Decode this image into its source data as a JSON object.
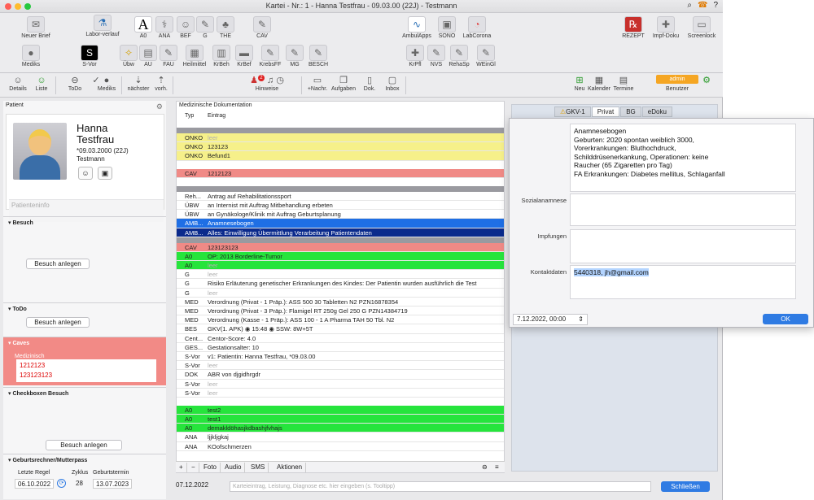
{
  "window": {
    "title": "Kartei - Nr.: 1 - Hanna Testfrau - 09.03.00 (22J)  -  Testmann"
  },
  "toolbar_top": [
    {
      "label": "Neuer Brief",
      "icon": "✉"
    },
    {
      "label": "Labor-verlauf",
      "icon": "⚗"
    },
    {
      "label": "A0",
      "icon": "A"
    },
    {
      "label": "ANA",
      "icon": "⚕"
    },
    {
      "label": "BEF",
      "icon": "☺"
    },
    {
      "label": "G",
      "icon": "✎"
    },
    {
      "label": "THE",
      "icon": "♣"
    },
    {
      "label": "CAV",
      "icon": "✎"
    },
    {
      "label": "AmbulApps",
      "icon": "∿"
    },
    {
      "label": "SONO",
      "icon": "▣"
    },
    {
      "label": "LabCorona",
      "icon": "◔"
    },
    {
      "label": "REZEPT",
      "icon": "℞"
    },
    {
      "label": "Impf-Doku",
      "icon": "✚"
    },
    {
      "label": "Screenlock",
      "icon": "▭"
    }
  ],
  "toolbar_mid": [
    {
      "label": "Mediks",
      "icon": "●"
    },
    {
      "label": "S-Vor",
      "icon": "S"
    },
    {
      "label": "Übw",
      "icon": "✧"
    },
    {
      "label": "AU",
      "icon": "▤"
    },
    {
      "label": "FAU",
      "icon": "✎"
    },
    {
      "label": "Heilmittel",
      "icon": "▦"
    },
    {
      "label": "KrBeh",
      "icon": "▥"
    },
    {
      "label": "KrBef",
      "icon": "▬"
    },
    {
      "label": "KrebsFF",
      "icon": "✎"
    },
    {
      "label": "MG",
      "icon": "✎"
    },
    {
      "label": "BESCH",
      "icon": "✎"
    },
    {
      "label": "KrPfl",
      "icon": "✚"
    },
    {
      "label": "NVS",
      "icon": "✎"
    },
    {
      "label": "RehaSp",
      "icon": "✎"
    },
    {
      "label": "WEinGl",
      "icon": "✎"
    }
  ],
  "navbar": {
    "details": "Details",
    "liste": "Liste",
    "todo": "ToDo",
    "mediks": "Mediks",
    "naechster": "nächster",
    "vorh": "vorh.",
    "hinweise": "Hinweise",
    "hinweise_badge": "2",
    "nachr": "+Nachr.",
    "aufgaben": "Aufgaben",
    "dok": "Dok.",
    "inbox": "Inbox",
    "neu": "Neu",
    "kalender": "Kalender",
    "termine": "Termine",
    "benutzer": "Benutzer",
    "user_badge": "admin"
  },
  "patient": {
    "header": "Patient",
    "first_name": "Hanna",
    "last_name": "Testfrau",
    "dob": "*09.03.2000 (22J)",
    "doctor": "Testmann",
    "info_placeholder": "Patienteninfo"
  },
  "sections": {
    "besuch": {
      "title": "Besuch",
      "button": "Besuch anlegen"
    },
    "todo": {
      "title": "ToDo",
      "button": "Besuch anlegen"
    },
    "caves": {
      "title": "Caves",
      "sub": "Medizinisch",
      "items": [
        "1212123",
        "123123123"
      ]
    },
    "checkboxen": {
      "title": "Checkboxen Besuch",
      "button": "Besuch anlegen"
    },
    "geburt": {
      "title": "Geburtsrechner/Mutterpass",
      "letzte_regel_label": "Letzte Regel",
      "letzte_regel": "06.10.2022",
      "zyklus_label": "Zyklus",
      "zyklus": "28",
      "geburtstermin_label": "Geburtstermin",
      "geburtstermin": "13.07.2023"
    }
  },
  "center": {
    "title": "Medizinische Dokumentation",
    "col_typ": "Typ",
    "col_eintrag": "Eintrag",
    "rows": [
      {
        "kind": "sep-grey"
      },
      {
        "kind": "yellow",
        "typ": "ONKO",
        "text": "leer",
        "ph": true
      },
      {
        "kind": "yellow",
        "typ": "ONKO",
        "text": "123123"
      },
      {
        "kind": "yellow",
        "typ": "ONKO",
        "text": "Befund1"
      },
      {
        "kind": "gap"
      },
      {
        "kind": "red",
        "typ": "CAV",
        "text": "1212123"
      },
      {
        "kind": "gap"
      },
      {
        "kind": "sep-grey"
      },
      {
        "kind": "",
        "typ": "Reh...",
        "text": "Antrag auf Rehabilitationssport"
      },
      {
        "kind": "",
        "typ": "ÜBW",
        "text": "an Internist mit Auftrag Mitbehandlung erbeten"
      },
      {
        "kind": "",
        "typ": "ÜBW",
        "text": "an Gynäkologe/Klinik mit Auftrag Geburtsplanung"
      },
      {
        "kind": "blue",
        "typ": "AMB...",
        "text": "Anamnesebogen"
      },
      {
        "kind": "navy",
        "typ": "AMB...",
        "text": "Alles: Einwilligung Übermittlung Verarbeitung Patientendaten"
      },
      {
        "kind": "sep-grey"
      },
      {
        "kind": "red",
        "typ": "CAV",
        "text": "123123123"
      },
      {
        "kind": "green",
        "typ": "A0",
        "text": "OP: 2013 Borderline-Tumor"
      },
      {
        "kind": "green",
        "typ": "A0",
        "text": "leer",
        "ph": true
      },
      {
        "kind": "",
        "typ": "G",
        "text": "leer",
        "ph": true
      },
      {
        "kind": "",
        "typ": "G",
        "text": "Risiko Erläuterung genetischer Erkrankungen des Kindes: Der Patientin wurden ausführlich die Test"
      },
      {
        "kind": "",
        "typ": "G",
        "text": "leer",
        "ph": true
      },
      {
        "kind": "",
        "typ": "MED",
        "text": "Verordnung (Privat - 1 Präp.): ASS 500 30 Tabletten N2 PZN16878354"
      },
      {
        "kind": "",
        "typ": "MED",
        "text": "Verordnung (Privat - 3 Präp.): Flamigel RT 250g Gel 250 G PZN14384719"
      },
      {
        "kind": "",
        "typ": "MED",
        "text": "Verordnung (Kasse - 1 Präp.): ASS 100 - 1 A Pharma TAH 50 Tbl. N2"
      },
      {
        "kind": "",
        "typ": "BES",
        "text": "GKV(1. APK) ◉ 15:48 ◉ SSW: 8W+5T"
      },
      {
        "kind": "",
        "typ": "Cent...",
        "text": "Centor-Score: 4.0"
      },
      {
        "kind": "",
        "typ": "GES...",
        "text": "Gestationsalter: 10"
      },
      {
        "kind": "",
        "typ": "S-Vor",
        "text": "v1: Patientin: Hanna Testfrau, *09.03.00"
      },
      {
        "kind": "",
        "typ": "S-Vor",
        "text": "leer",
        "ph": true
      },
      {
        "kind": "",
        "typ": "DOK",
        "text": "ABR von djgidhrgdr"
      },
      {
        "kind": "",
        "typ": "S-Vor",
        "text": "leer",
        "ph": true
      },
      {
        "kind": "",
        "typ": "S-Vor",
        "text": "leer",
        "ph": true
      },
      {
        "kind": "gap"
      },
      {
        "kind": "green",
        "typ": "A0",
        "text": "test2"
      },
      {
        "kind": "green",
        "typ": "A0",
        "text": "test1"
      },
      {
        "kind": "green",
        "typ": "A0",
        "text": "demakldöhasjkdbashjfvhajs"
      },
      {
        "kind": "",
        "typ": "ANA",
        "text": "ljjkljgkaj"
      },
      {
        "kind": "",
        "typ": "ANA",
        "text": "KOofschmerzen"
      }
    ],
    "bottom": {
      "plus": "+",
      "minus": "−",
      "foto": "Foto",
      "audio": "Audio",
      "sms": "SMS",
      "aktionen": "Aktionen"
    }
  },
  "input_bar": {
    "date": "07.12.2022",
    "placeholder": "Karteieintrag, Leistung, Diagnose etc. hier eingeben (s. Tooltipp)",
    "close": "Schließen"
  },
  "right_tabs": [
    "GKV-1",
    "Privat",
    "BG",
    "eDoku"
  ],
  "popup": {
    "anamnese_lines": [
      "Anamnesebogen",
      "Geburten: 2020 spontan weiblich 3000,",
      "Vorerkrankungen: Bluthochdruck,",
      "Schilddrüsenerkankung, Operationen: keine",
      "Raucher (65 Zigaretten pro Tag)",
      "FA Erkrankungen: Diabetes mellitus, Schlaganfall"
    ],
    "sozial_label": "Sozialanamnese",
    "impfungen_label": "Impfungen",
    "kontakt_label": "Kontaktdaten",
    "kontakt_value": "5440318, jh@gmail.com",
    "date": "7.12.2022, 00:00",
    "ok": "OK"
  },
  "colors": {
    "yellow": "#f6f08a",
    "red": "#f08a86",
    "blue": "#1f6fe5",
    "navy": "#0a2a8c",
    "green": "#26e43c",
    "accent": "#2f7be3"
  }
}
